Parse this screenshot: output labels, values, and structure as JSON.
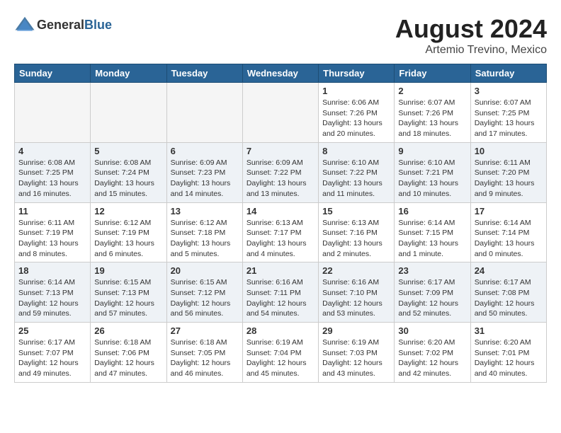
{
  "logo": {
    "text_general": "General",
    "text_blue": "Blue"
  },
  "header": {
    "month_year": "August 2024",
    "location": "Artemio Trevino, Mexico"
  },
  "weekdays": [
    "Sunday",
    "Monday",
    "Tuesday",
    "Wednesday",
    "Thursday",
    "Friday",
    "Saturday"
  ],
  "weeks": [
    [
      {
        "day": "",
        "info": ""
      },
      {
        "day": "",
        "info": ""
      },
      {
        "day": "",
        "info": ""
      },
      {
        "day": "",
        "info": ""
      },
      {
        "day": "1",
        "info": "Sunrise: 6:06 AM\nSunset: 7:26 PM\nDaylight: 13 hours\nand 20 minutes."
      },
      {
        "day": "2",
        "info": "Sunrise: 6:07 AM\nSunset: 7:26 PM\nDaylight: 13 hours\nand 18 minutes."
      },
      {
        "day": "3",
        "info": "Sunrise: 6:07 AM\nSunset: 7:25 PM\nDaylight: 13 hours\nand 17 minutes."
      }
    ],
    [
      {
        "day": "4",
        "info": "Sunrise: 6:08 AM\nSunset: 7:25 PM\nDaylight: 13 hours\nand 16 minutes."
      },
      {
        "day": "5",
        "info": "Sunrise: 6:08 AM\nSunset: 7:24 PM\nDaylight: 13 hours\nand 15 minutes."
      },
      {
        "day": "6",
        "info": "Sunrise: 6:09 AM\nSunset: 7:23 PM\nDaylight: 13 hours\nand 14 minutes."
      },
      {
        "day": "7",
        "info": "Sunrise: 6:09 AM\nSunset: 7:22 PM\nDaylight: 13 hours\nand 13 minutes."
      },
      {
        "day": "8",
        "info": "Sunrise: 6:10 AM\nSunset: 7:22 PM\nDaylight: 13 hours\nand 11 minutes."
      },
      {
        "day": "9",
        "info": "Sunrise: 6:10 AM\nSunset: 7:21 PM\nDaylight: 13 hours\nand 10 minutes."
      },
      {
        "day": "10",
        "info": "Sunrise: 6:11 AM\nSunset: 7:20 PM\nDaylight: 13 hours\nand 9 minutes."
      }
    ],
    [
      {
        "day": "11",
        "info": "Sunrise: 6:11 AM\nSunset: 7:19 PM\nDaylight: 13 hours\nand 8 minutes."
      },
      {
        "day": "12",
        "info": "Sunrise: 6:12 AM\nSunset: 7:19 PM\nDaylight: 13 hours\nand 6 minutes."
      },
      {
        "day": "13",
        "info": "Sunrise: 6:12 AM\nSunset: 7:18 PM\nDaylight: 13 hours\nand 5 minutes."
      },
      {
        "day": "14",
        "info": "Sunrise: 6:13 AM\nSunset: 7:17 PM\nDaylight: 13 hours\nand 4 minutes."
      },
      {
        "day": "15",
        "info": "Sunrise: 6:13 AM\nSunset: 7:16 PM\nDaylight: 13 hours\nand 2 minutes."
      },
      {
        "day": "16",
        "info": "Sunrise: 6:14 AM\nSunset: 7:15 PM\nDaylight: 13 hours\nand 1 minute."
      },
      {
        "day": "17",
        "info": "Sunrise: 6:14 AM\nSunset: 7:14 PM\nDaylight: 13 hours\nand 0 minutes."
      }
    ],
    [
      {
        "day": "18",
        "info": "Sunrise: 6:14 AM\nSunset: 7:13 PM\nDaylight: 12 hours\nand 59 minutes."
      },
      {
        "day": "19",
        "info": "Sunrise: 6:15 AM\nSunset: 7:13 PM\nDaylight: 12 hours\nand 57 minutes."
      },
      {
        "day": "20",
        "info": "Sunrise: 6:15 AM\nSunset: 7:12 PM\nDaylight: 12 hours\nand 56 minutes."
      },
      {
        "day": "21",
        "info": "Sunrise: 6:16 AM\nSunset: 7:11 PM\nDaylight: 12 hours\nand 54 minutes."
      },
      {
        "day": "22",
        "info": "Sunrise: 6:16 AM\nSunset: 7:10 PM\nDaylight: 12 hours\nand 53 minutes."
      },
      {
        "day": "23",
        "info": "Sunrise: 6:17 AM\nSunset: 7:09 PM\nDaylight: 12 hours\nand 52 minutes."
      },
      {
        "day": "24",
        "info": "Sunrise: 6:17 AM\nSunset: 7:08 PM\nDaylight: 12 hours\nand 50 minutes."
      }
    ],
    [
      {
        "day": "25",
        "info": "Sunrise: 6:17 AM\nSunset: 7:07 PM\nDaylight: 12 hours\nand 49 minutes."
      },
      {
        "day": "26",
        "info": "Sunrise: 6:18 AM\nSunset: 7:06 PM\nDaylight: 12 hours\nand 47 minutes."
      },
      {
        "day": "27",
        "info": "Sunrise: 6:18 AM\nSunset: 7:05 PM\nDaylight: 12 hours\nand 46 minutes."
      },
      {
        "day": "28",
        "info": "Sunrise: 6:19 AM\nSunset: 7:04 PM\nDaylight: 12 hours\nand 45 minutes."
      },
      {
        "day": "29",
        "info": "Sunrise: 6:19 AM\nSunset: 7:03 PM\nDaylight: 12 hours\nand 43 minutes."
      },
      {
        "day": "30",
        "info": "Sunrise: 6:20 AM\nSunset: 7:02 PM\nDaylight: 12 hours\nand 42 minutes."
      },
      {
        "day": "31",
        "info": "Sunrise: 6:20 AM\nSunset: 7:01 PM\nDaylight: 12 hours\nand 40 minutes."
      }
    ]
  ]
}
